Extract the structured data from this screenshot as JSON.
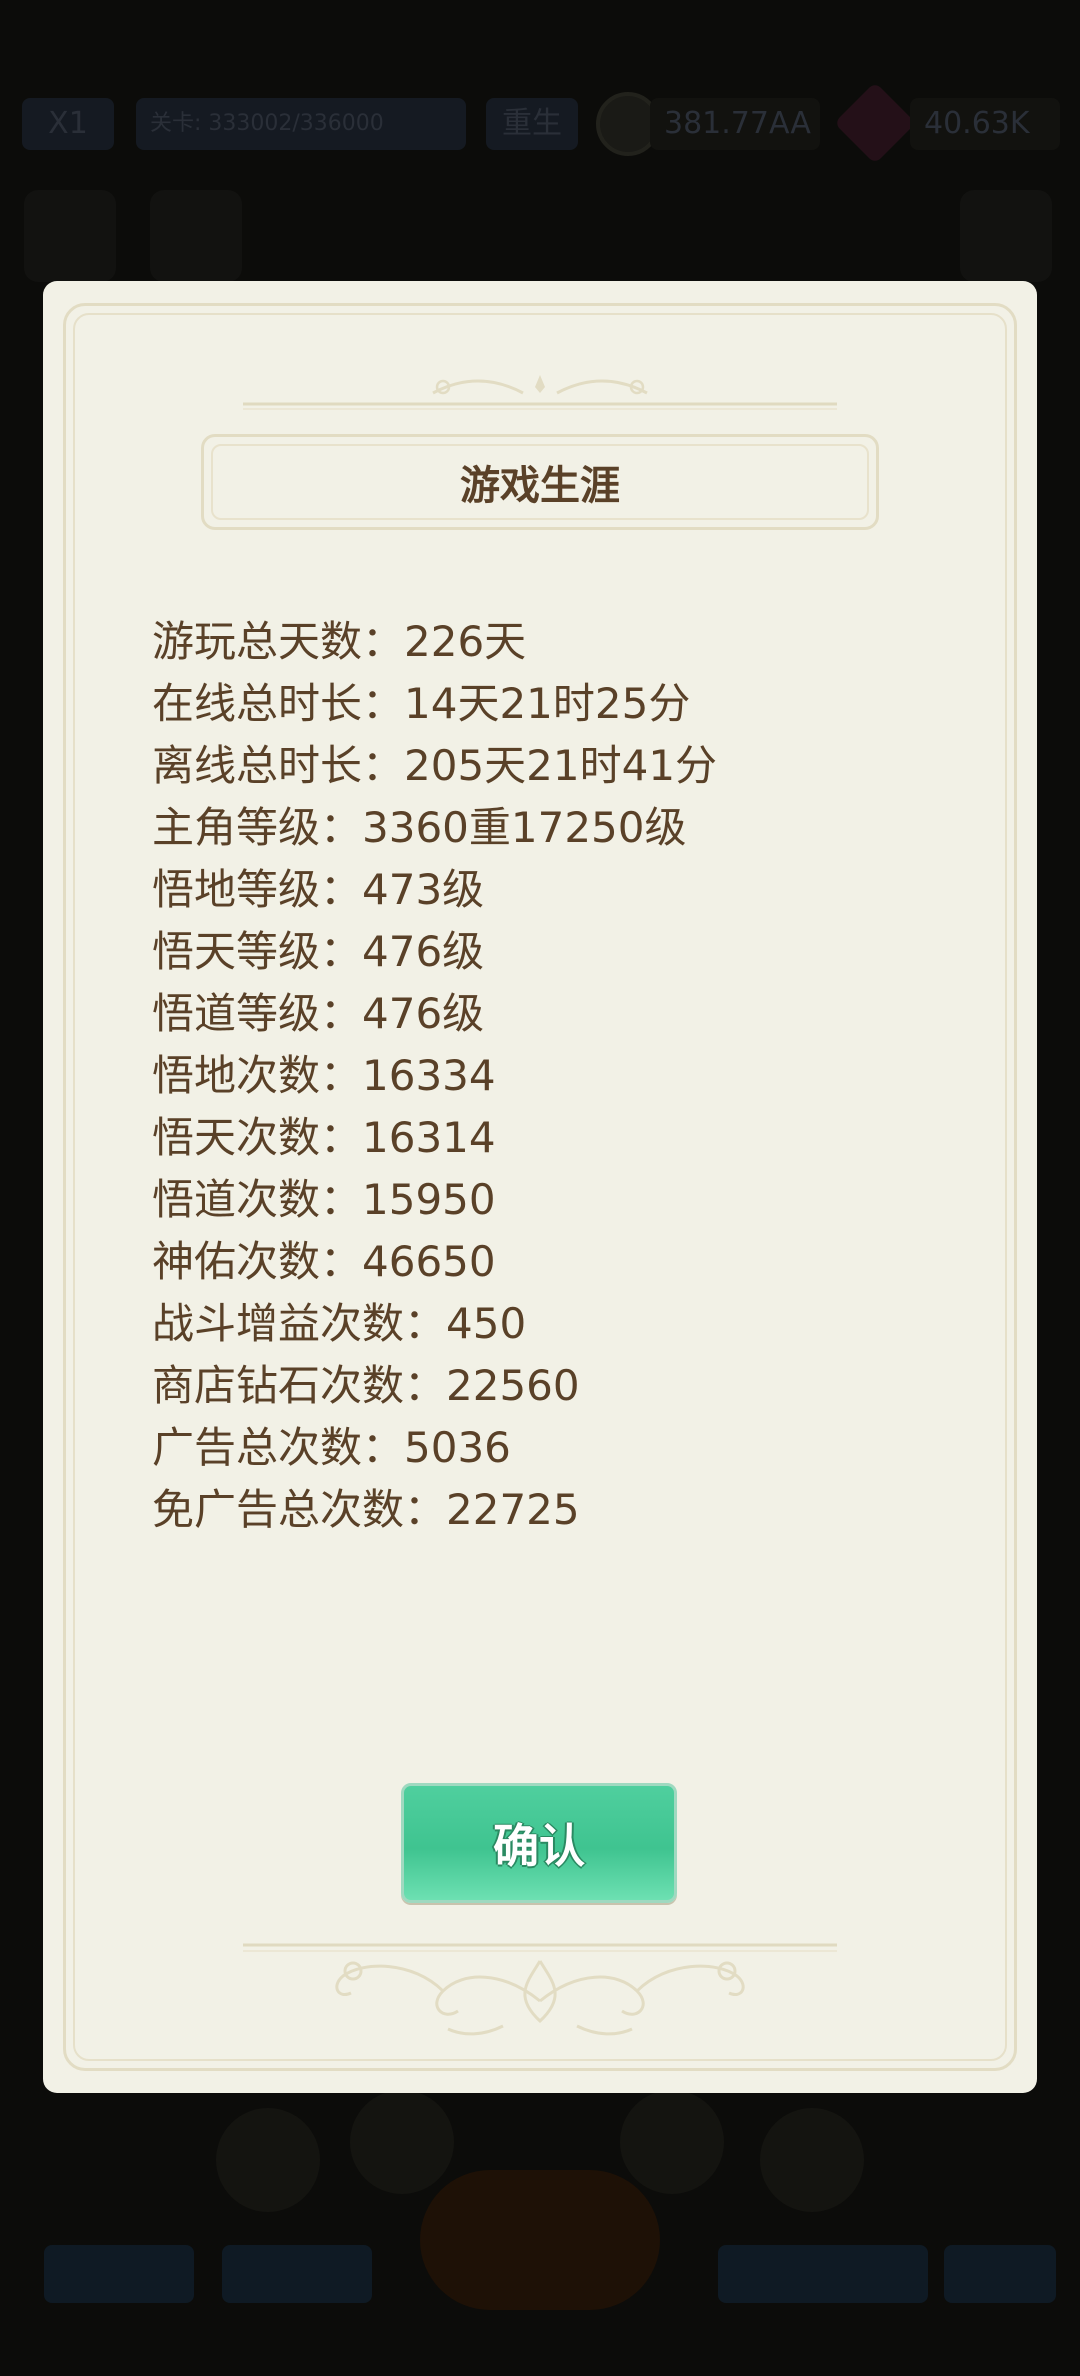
{
  "background": {
    "speed_label": "X1",
    "stage_label": "关卡: 333002/336000",
    "rebirth_label": "重生",
    "gold_amount": "381.77AA",
    "gem_amount": "40.63K"
  },
  "dialog": {
    "title": "游戏生涯",
    "stats": [
      "游玩总天数：226天",
      "在线总时长：14天21时25分",
      "离线总时长：205天21时41分",
      "主角等级：3360重17250级",
      "悟地等级：473级",
      "悟天等级：476级",
      "悟道等级：476级",
      "悟地次数：16334",
      "悟天次数：16314",
      "悟道次数：15950",
      "神佑次数：46650",
      "战斗增益次数：450",
      "商店钻石次数：22560",
      "广告总次数：5036",
      "免广告总次数：22725"
    ],
    "confirm_label": "确认"
  },
  "colors": {
    "panel_bg": "#f2f1e6",
    "text_brown": "#5a4128",
    "button_green": "#3fc490"
  }
}
